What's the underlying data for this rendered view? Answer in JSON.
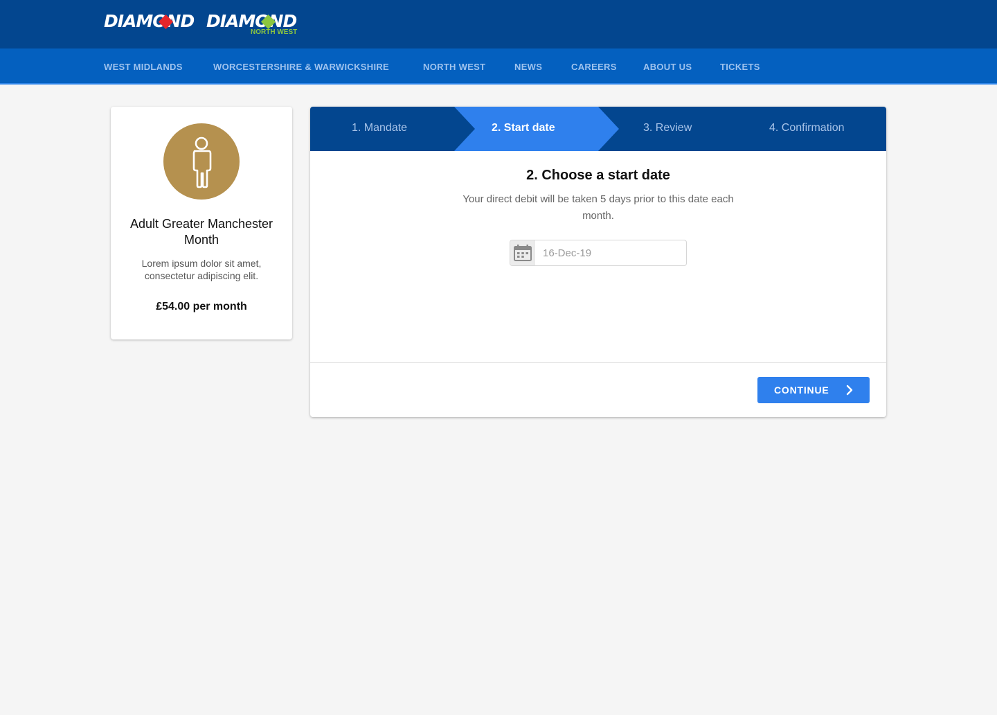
{
  "header": {
    "logo1": {
      "text": "DIAMOND"
    },
    "logo2": {
      "text": "DIAMOND",
      "sub": "NORTH WEST"
    },
    "colors": {
      "bar": "#03468f",
      "nav": "#0460bf",
      "accent_red": "#e5252a",
      "accent_green": "#8cc63f"
    }
  },
  "nav": {
    "items": [
      {
        "label": "WEST MIDLANDS"
      },
      {
        "label": "WORCESTERSHIRE  & WARWICKSHIRE"
      },
      {
        "label": "NORTH WEST"
      },
      {
        "label": "NEWS"
      },
      {
        "label": "CAREERS"
      },
      {
        "label": "ABOUT US"
      },
      {
        "label": "TICKETS"
      }
    ]
  },
  "ticket": {
    "icon": "person-icon",
    "title": "Adult Greater Manchester Month",
    "description": "Lorem ipsum dolor sit amet, consectetur adipiscing elit.",
    "price": "£54.00 per month",
    "avatar_color": "#b5914f"
  },
  "steps": {
    "items": [
      {
        "label": "1. Mandate"
      },
      {
        "label": "2. Start date"
      },
      {
        "label": "3. Review"
      },
      {
        "label": "4. Confirmation"
      }
    ],
    "active_index": 1,
    "colors": {
      "inactive": "#03468f",
      "active": "#2f80ed"
    }
  },
  "form": {
    "heading": "2. Choose a start date",
    "subtext": "Your direct debit will be taken 5 days prior to this date each month.",
    "date_value": "16-Dec-19",
    "calendar_icon": "calendar-icon",
    "continue_label": "CONTINUE",
    "continue_icon": "chevron-right-icon"
  }
}
